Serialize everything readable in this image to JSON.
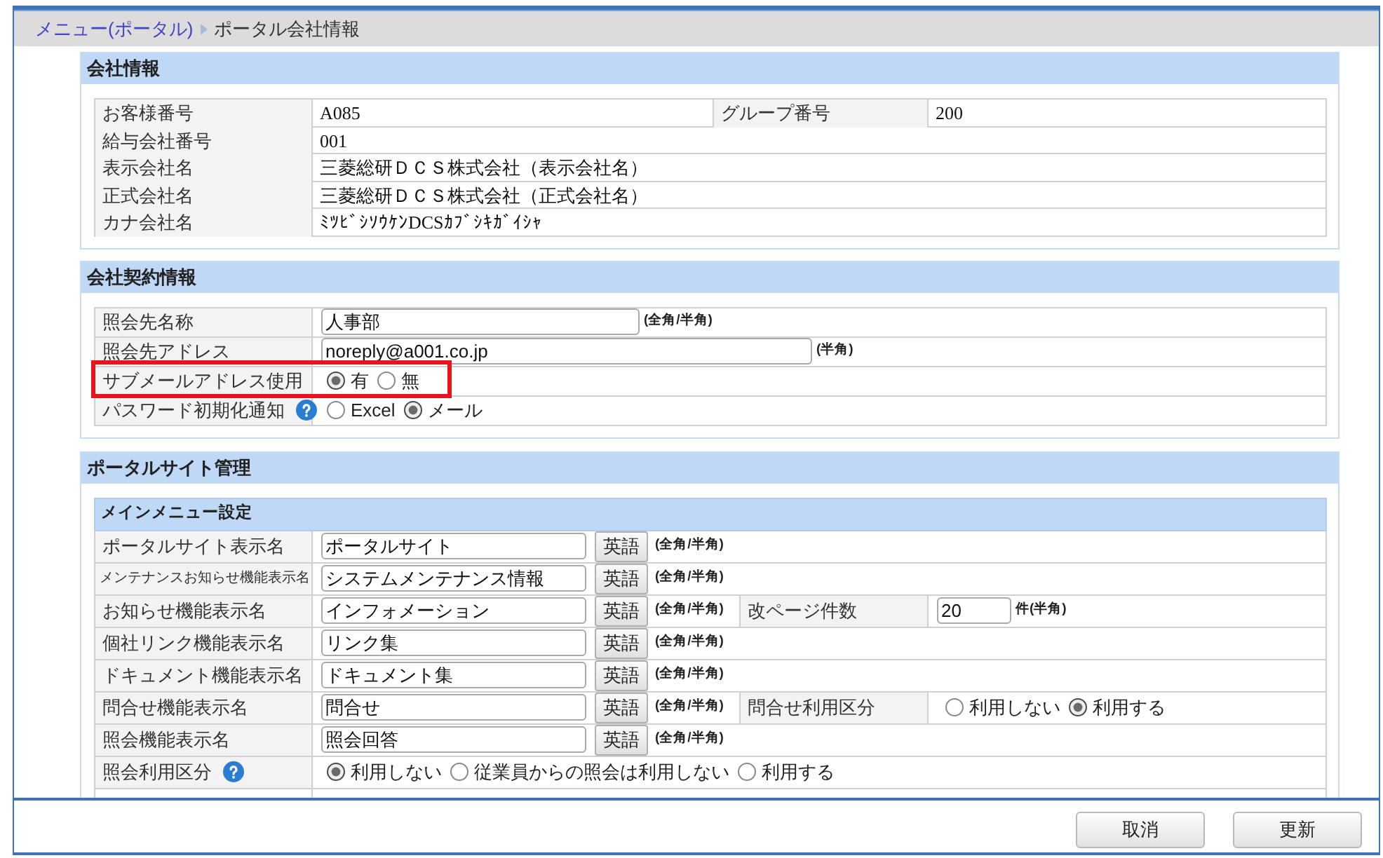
{
  "breadcrumb": [
    {
      "label": "メニュー(ポータル)",
      "kind": "link"
    },
    {
      "label": "ポータル会社情報",
      "kind": "current"
    }
  ],
  "company_info": {
    "title": "会社情報",
    "rows": [
      {
        "cells": [
          {
            "kind": "label",
            "text": "お客様番号"
          },
          {
            "kind": "value",
            "text": "A085"
          },
          {
            "kind": "label",
            "text": "グループ番号"
          },
          {
            "kind": "value",
            "text": "200"
          }
        ]
      },
      {
        "cells": [
          {
            "kind": "label",
            "text": "給与会社番号"
          },
          {
            "kind": "value",
            "text": "001"
          }
        ]
      },
      {
        "cells": [
          {
            "kind": "label",
            "text": "表示会社名"
          },
          {
            "kind": "value",
            "text": "三菱総研ＤＣＳ株式会社（表示会社名）"
          }
        ]
      },
      {
        "cells": [
          {
            "kind": "label",
            "text": "正式会社名"
          },
          {
            "kind": "value",
            "text": "三菱総研ＤＣＳ株式会社（正式会社名）"
          }
        ]
      },
      {
        "cells": [
          {
            "kind": "label",
            "text": "カナ会社名"
          },
          {
            "kind": "value",
            "text": "ﾐﾂﾋﾞｼｿｳｹﾝDCSｶﾌﾞｼｷｶﾞｲｼｬ"
          }
        ]
      }
    ]
  },
  "contract_info": {
    "title": "会社契約情報",
    "rows": [
      {
        "label": "照会先名称",
        "help": false,
        "highlighted": false,
        "control": {
          "kind": "text",
          "value": "人事部",
          "hint": "(全角/半角)"
        }
      },
      {
        "label": "照会先アドレス",
        "help": false,
        "highlighted": false,
        "control": {
          "kind": "text",
          "value": "noreply@a001.co.jp",
          "hint": "(半角)"
        }
      },
      {
        "label": "サブメールアドレス使用",
        "help": false,
        "highlighted": true,
        "control": {
          "kind": "radio",
          "options": [
            {
              "label": "有",
              "selected": true
            },
            {
              "label": "無",
              "selected": false
            }
          ]
        }
      },
      {
        "label": "パスワード初期化通知",
        "help": true,
        "highlighted": false,
        "control": {
          "kind": "radio",
          "options": [
            {
              "label": "Excel",
              "selected": false
            },
            {
              "label": "メール",
              "selected": true
            }
          ]
        }
      }
    ]
  },
  "portal_management": {
    "title": "ポータルサイト管理",
    "main_menu": {
      "title": "メインメニュー設定",
      "rows": [
        {
          "label": "ポータルサイト表示名",
          "help": false,
          "control": {
            "kind": "text",
            "value": "ポータルサイト",
            "button": "英語",
            "hint": "(全角/半角)"
          }
        },
        {
          "label": "メンテナンスお知らせ機能表示名",
          "help": false,
          "control": {
            "kind": "text",
            "value": "システムメンテナンス情報",
            "button": "英語",
            "hint": "(全角/半角)"
          }
        },
        {
          "label": "お知らせ機能表示名",
          "help": false,
          "control": {
            "kind": "text",
            "value": "インフォメーション",
            "button": "英語",
            "hint": "(全角/半角)"
          },
          "side": {
            "label": "改ページ件数",
            "control": {
              "kind": "text",
              "value": "20",
              "hint": "件(半角)"
            }
          }
        },
        {
          "label": "個社リンク機能表示名",
          "help": false,
          "control": {
            "kind": "text",
            "value": "リンク集",
            "button": "英語",
            "hint": "(全角/半角)"
          }
        },
        {
          "label": "ドキュメント機能表示名",
          "help": false,
          "control": {
            "kind": "text",
            "value": "ドキュメント集",
            "button": "英語",
            "hint": "(全角/半角)"
          }
        },
        {
          "label": "問合せ機能表示名",
          "help": false,
          "control": {
            "kind": "text",
            "value": "問合せ",
            "button": "英語",
            "hint": "(全角/半角)"
          },
          "side": {
            "label": "問合せ利用区分",
            "control": {
              "kind": "radio",
              "options": [
                {
                  "label": "利用しない",
                  "selected": false
                },
                {
                  "label": "利用する",
                  "selected": true
                }
              ]
            }
          }
        },
        {
          "label": "照会機能表示名",
          "help": false,
          "control": {
            "kind": "text",
            "value": "照会回答",
            "button": "英語",
            "hint": "(全角/半角)"
          }
        },
        {
          "label": "照会利用区分",
          "help": true,
          "control": {
            "kind": "radio",
            "options": [
              {
                "label": "利用しない",
                "selected": true
              },
              {
                "label": "従業員からの照会は利用しない",
                "selected": false
              },
              {
                "label": "利用する",
                "selected": false
              }
            ]
          }
        }
      ]
    }
  },
  "footer": {
    "buttons": [
      "取消",
      "更新"
    ]
  }
}
